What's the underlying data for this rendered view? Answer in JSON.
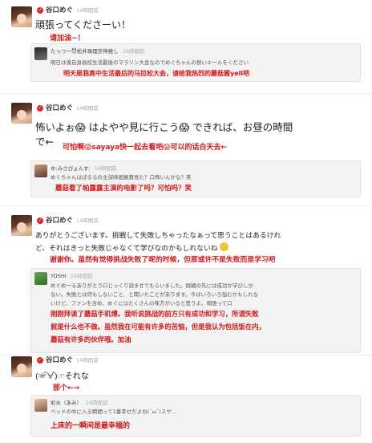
{
  "posts": [
    {
      "user": "谷口めぐ",
      "time": "14時間前",
      "text": "頑張ってくださーい！",
      "translation": "请加油~！",
      "reply": {
        "user": "たっつー😈松井珠理奈神推し",
        "time": "16時間前",
        "text": "明日は僕自身高校生活最後のマラソン大会なのでめぐちゃんの熱いエールをください",
        "translation": "明天是我高中生活最后的马拉松大会，请给我热烈的蘑菇酱yell吧"
      }
    },
    {
      "user": "谷口めぐ",
      "time": "14時間前",
      "text_line1": "怖いよぉ😱 はよやや見に行こう😱 できれば、お昼の時間",
      "text_line2": "で←",
      "translation": "可怕啊😱sayaya快一起去看吧😱可以的话白天去←",
      "reply": {
        "user": "ゆ:みさぴょんす:",
        "time": "16時間前",
        "text": "めぐちゃんはばるるの主演映画観賞見た？口怖いんかな？笑",
        "translation": "蘑菇看了帕露露主演的电影了吗？可怕吗？笑"
      }
    },
    {
      "user": "谷口めぐ",
      "time": "14時間前",
      "text_line1": "ありがとうございます。挑戦して失敗しちゃったなぁって思うことはあるけれ",
      "text_line2": "ど、それはきっと失敗じゃなくて学びなのかもしれないね",
      "translation": "谢谢你。虽然有觉得挑战失败了呢的时候，但那或许不是失败而是学习吧",
      "reply": {
        "user": "YOSHI",
        "time": "18時間前",
        "lines": [
          "めぐめーるありがとう口じっくり読ませてもらいました。挑戦の先には成功か学びしか",
          "ない。失敗とは何もしないこと、と聞いたことがあります。今はいろいろ悩むかもしれな",
          "いけど、ファンを含め、めぐにはたくさんの味方がいると思うよ。頑張って口"
        ],
        "translation_lines": [
          "刚刚拜读了蘑菇手机博。我听说挑战的前方只有成功和学习，所谓失败",
          "就是什么也不做。虽然我在可能有许多的苦恼，但是我认为包括饭在内，",
          "蘑菇有许多的伙伴哦。加油"
        ]
      }
    },
    {
      "user": "谷口めぐ",
      "time": "14時間前",
      "text": "(☞゚∀゚)☞それな",
      "translation": "那个←→",
      "reply": {
        "user": "彩水（あみ）",
        "time": "16時間前",
        "text": "ベッドの中に入る瞬間って1番幸せだよね(´ω`)スヤ…",
        "translation": "上床的一瞬间是最幸福的"
      }
    }
  ]
}
